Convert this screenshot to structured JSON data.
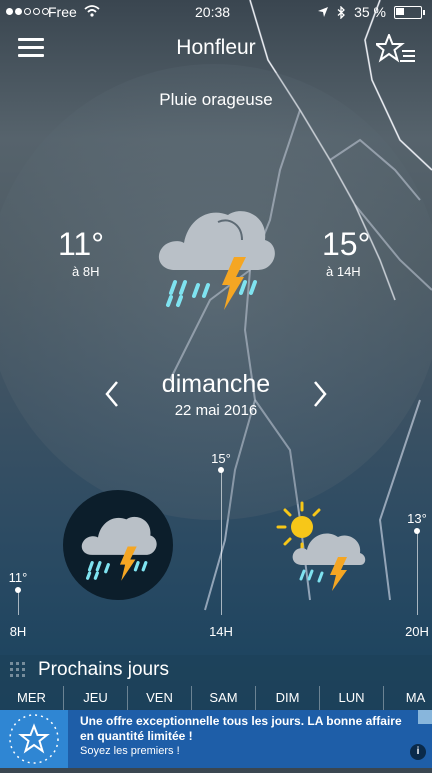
{
  "status_bar": {
    "carrier": "Free",
    "time": "20:38",
    "battery": "35 %"
  },
  "header": {
    "city": "Honfleur",
    "condition": "Pluie orageuse"
  },
  "today": {
    "low_temp": "11°",
    "low_time": "à 8H",
    "high_temp": "15°",
    "high_time": "à 14H",
    "weather_icon": "thunderstorm-rain-icon",
    "day_name": "dimanche",
    "date": "22 mai 2016"
  },
  "hourly": [
    {
      "hour": "8H",
      "temp": "11°",
      "icon": "thunderstorm-rain-icon"
    },
    {
      "hour": "14H",
      "temp": "15°",
      "icon": ""
    },
    {
      "hour": "20H",
      "temp": "13°",
      "icon": "sun-cloud-thunderstorm-icon"
    }
  ],
  "next_days": {
    "title": "Prochains jours",
    "days": [
      "MER",
      "JEU",
      "VEN",
      "SAM",
      "DIM",
      "LUN",
      "MA"
    ]
  },
  "ad": {
    "line1": "Une offre exceptionnelle tous les jours. LA bonne affaire",
    "line2": "en quantité limitée !",
    "sub": "Soyez les premiers !",
    "info": "i"
  },
  "colors": {
    "rain": "#7fe3f0",
    "bolt": "#f5a623",
    "sun": "#f7c718",
    "cloud": "#b9c0c7",
    "ad_bg": "#1e5ea8"
  }
}
